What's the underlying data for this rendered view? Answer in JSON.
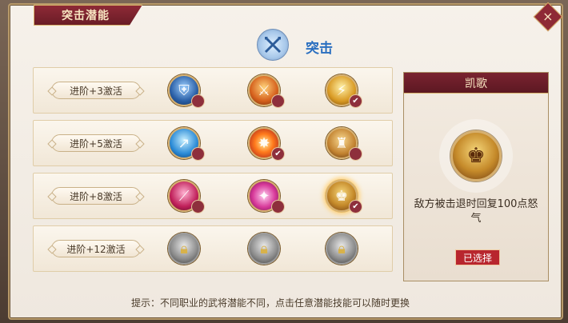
{
  "window": {
    "title": "突击潜能",
    "close_icon": "close-icon"
  },
  "header": {
    "title": "突击",
    "icon": "crossed-swords-icon"
  },
  "rows": [
    {
      "label": "进阶+3激活",
      "skills": [
        {
          "icon": "shield-icon",
          "state": "locked-dot"
        },
        {
          "icon": "warrior-slash-icon",
          "state": "locked-dot"
        },
        {
          "icon": "gold-blade-icon",
          "state": "checked"
        }
      ]
    },
    {
      "label": "进阶+5激活",
      "skills": [
        {
          "icon": "lightning-spear-icon",
          "state": "locked-dot"
        },
        {
          "icon": "explosion-icon",
          "state": "checked"
        },
        {
          "icon": "warrior-gold-icon",
          "state": "locked-dot"
        }
      ]
    },
    {
      "label": "进阶+8激活",
      "skills": [
        {
          "icon": "magenta-slash-icon",
          "state": "locked-dot"
        },
        {
          "icon": "pink-burst-icon",
          "state": "locked-dot"
        },
        {
          "icon": "warrior-triumph-icon",
          "state": "checked",
          "selected": true
        }
      ]
    },
    {
      "label": "进阶+12激活",
      "skills": [
        {
          "icon": "padlock-icon",
          "state": "locked"
        },
        {
          "icon": "padlock-icon",
          "state": "locked"
        },
        {
          "icon": "padlock-icon",
          "state": "locked"
        }
      ]
    }
  ],
  "detail": {
    "title": "凯歌",
    "description": "敌方被击退时回复100点怒气",
    "status": "已选择",
    "icon": "warrior-triumph-icon"
  },
  "footer": {
    "tip": "提示：不同职业的武将潜能不同，点击任意潜能技能可以随时更换"
  }
}
